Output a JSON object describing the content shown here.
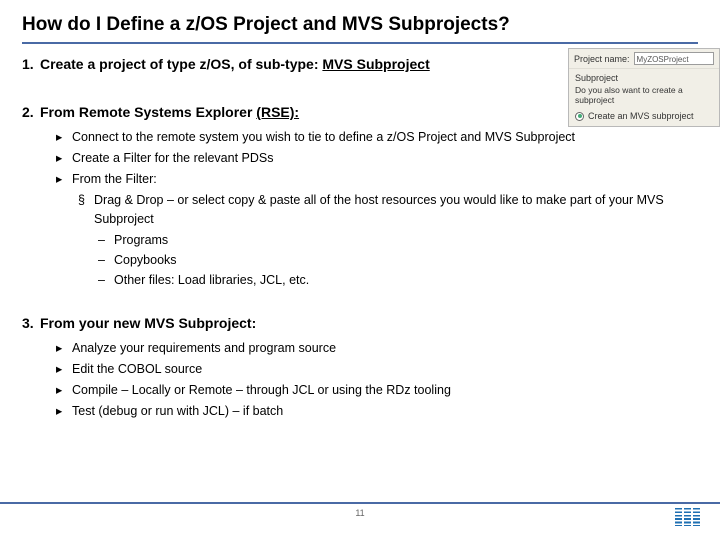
{
  "title": "How do I Define a z/OS Project and MVS Subprojects?",
  "steps": {
    "s1": {
      "num": "1.",
      "before": "Create a project of type z/OS, of sub-type: ",
      "ul": "MVS Subproject"
    },
    "s2": {
      "num": "2.",
      "before": "From Remote Systems Explorer ",
      "ul": "(RSE):"
    },
    "s3": {
      "num": "3.",
      "text": "From your new MVS Subproject:"
    }
  },
  "s2_bullets": [
    "Connect to the remote system you wish to tie to define a z/OS Project and MVS Subproject",
    "Create a Filter for the relevant PDSs",
    "From the Filter:"
  ],
  "s2_sub": {
    "mk": "§",
    "text": "Drag & Drop – or select copy & paste all of the host resources you would like to make part of your MVS Subproject"
  },
  "s2_subsub": [
    "Programs",
    "Copybooks",
    "Other files: Load libraries, JCL, etc."
  ],
  "s3_bullets": [
    "Analyze your requirements and program source",
    "Edit the COBOL source",
    "Compile – Locally or Remote – through JCL or using the RDz tooling",
    "Test (debug or run with JCL) – if batch"
  ],
  "screenshot": {
    "project_label": "Project name:",
    "project_value": "MyZOSProject",
    "group": "Subproject",
    "prompt": "Do you also want to create a subproject",
    "radio": "Create an MVS subproject"
  },
  "page_number": "11",
  "markers": {
    "tri": "▸",
    "dash": "–"
  }
}
